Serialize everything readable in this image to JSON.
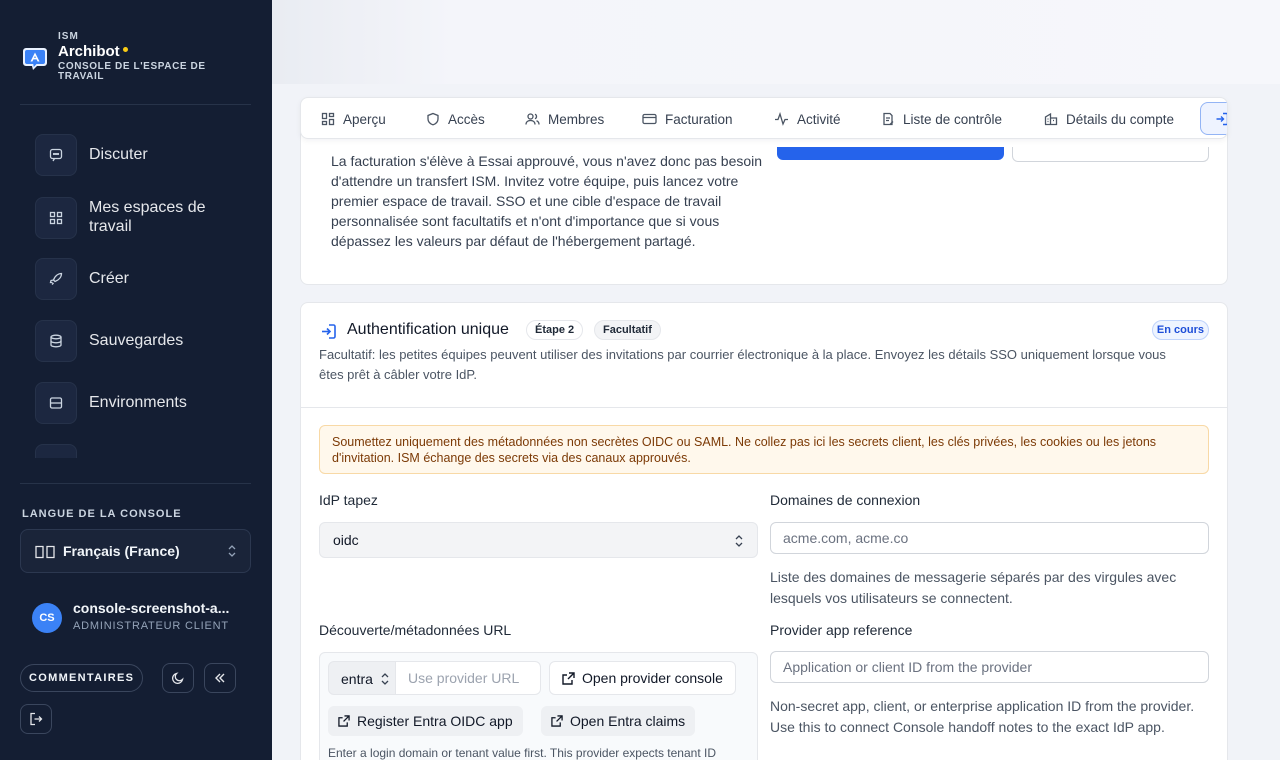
{
  "sidebar": {
    "org_small": "ISM",
    "app_name": "Archibot",
    "app_subtitle": "CONSOLE DE L'ESPACE DE TRAVAIL",
    "nav": [
      {
        "label": "Discuter",
        "icon": "chat-icon"
      },
      {
        "label": "Mes espaces de travail",
        "icon": "grid-icon"
      },
      {
        "label": "Créer",
        "icon": "rocket-icon"
      },
      {
        "label": "Sauvegardes",
        "icon": "database-icon"
      },
      {
        "label": "Environments",
        "icon": "server-icon"
      }
    ],
    "language_label": "LANGUE DE LA CONSOLE",
    "language_value": "Français (France)",
    "user": {
      "initials": "CS",
      "name": "console-screenshot-a...",
      "role": "ADMINISTRATEUR CLIENT"
    },
    "feedback_label": "COMMENTAIRES"
  },
  "tabs": [
    {
      "label": "Aperçu",
      "icon": "grid-icon"
    },
    {
      "label": "Accès",
      "icon": "shield-icon"
    },
    {
      "label": "Membres",
      "icon": "users-icon"
    },
    {
      "label": "Facturation",
      "icon": "credit-card-icon"
    },
    {
      "label": "Activité",
      "icon": "activity-icon"
    },
    {
      "label": "Liste de contrôle",
      "icon": "clipboard-icon"
    },
    {
      "label": "Détails du compte",
      "icon": "building-icon"
    }
  ],
  "billing_card": {
    "text": "La facturation s'élève à Essai approuvé, vous n'avez donc pas besoin d'attendre un transfert ISM. Invitez votre équipe, puis lancez votre premier espace de travail. SSO et une cible d'espace de travail personnalisée sont facultatifs et n'ont d'importance que si vous dépassez les valeurs par défaut de l'hébergement partagé."
  },
  "sso": {
    "title": "Authentification unique",
    "step": "Étape 2",
    "optional": "Facultatif",
    "status": "En cours",
    "description": "Facultatif: les petites équipes peuvent utiliser des invitations par courrier électronique à la place. Envoyez les détails SSO uniquement lorsque vous êtes prêt à câbler votre IdP.",
    "warning": "Soumettez uniquement des métadonnées non secrètes OIDC ou SAML. Ne collez pas ici les secrets client, les clés privées, les cookies ou les jetons d'invitation. ISM échange des secrets via des canaux approuvés.",
    "idp_type_label": "IdP tapez",
    "idp_type_value": "oidc",
    "domains_label": "Domaines de connexion",
    "domains_placeholder": "acme.com, acme.co",
    "domains_help": "Liste des domaines de messagerie séparés par des virgules avec lesquels vos utilisateurs se connectent.",
    "discovery_label": "Découverte/métadonnées URL",
    "provider_value": "entra",
    "provider_url_placeholder": "Use provider URL",
    "open_console": "Open provider console",
    "register_app": "Register Entra OIDC app",
    "open_claims": "Open Entra claims",
    "url_note": "Enter a login domain or tenant value first. This provider expects tenant ID",
    "app_ref_label": "Provider app reference",
    "app_ref_placeholder": "Application or client ID from the provider",
    "app_ref_help": "Non-secret app, client, or enterprise application ID from the provider. Use this to connect Console handoff notes to the exact IdP app."
  },
  "colors": {
    "sidebar_bg": "#141e33",
    "accent": "#2563eb",
    "brand_dot": "#facc15",
    "warning_bg": "#fff8ec"
  }
}
